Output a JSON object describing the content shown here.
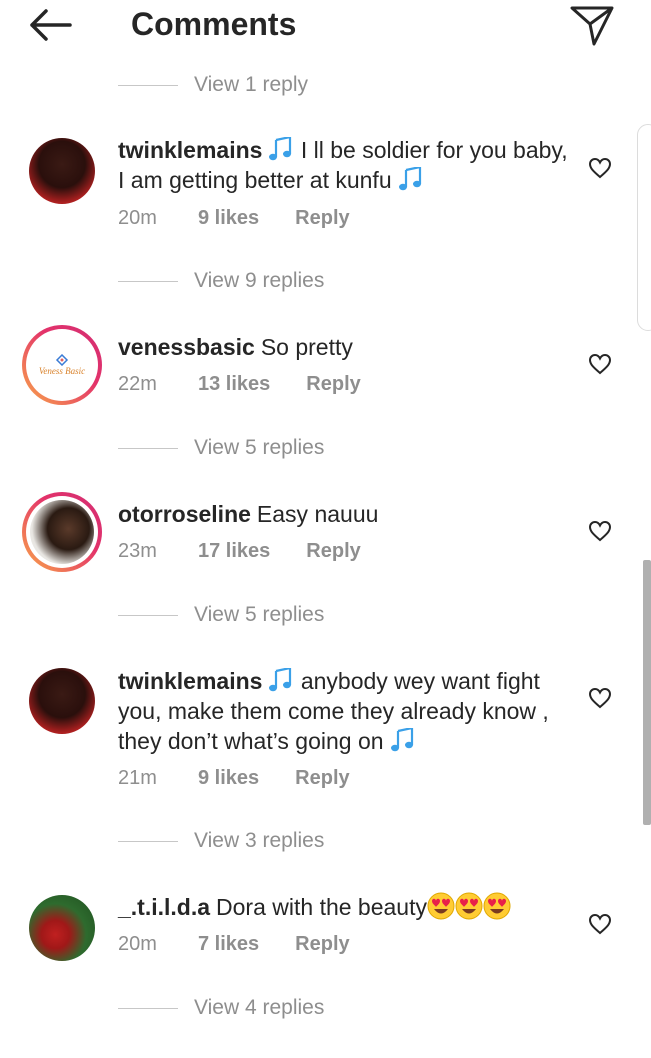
{
  "header": {
    "title": "Comments",
    "back_icon": "arrow-left-icon",
    "share_icon": "paper-plane-icon"
  },
  "top_view_replies": "View 1 reply",
  "comments": [
    {
      "username": "twinklemains",
      "text_a": "I ll be soldier for you baby, I am getting better at kunfu",
      "time": "20m",
      "likes": "9 likes",
      "reply": "Reply",
      "view_replies": "View 9 replies"
    },
    {
      "username": "venessbasic",
      "text": "So pretty",
      "time": "22m",
      "likes": "13 likes",
      "reply": "Reply",
      "view_replies": "View 5 replies",
      "avatar_text": "Veness Basic"
    },
    {
      "username": "otorroseline",
      "text": "Easy nauuu",
      "time": "23m",
      "likes": "17 likes",
      "reply": "Reply",
      "view_replies": "View 5 replies"
    },
    {
      "username": "twinklemains",
      "text_a": "anybody wey want fight you, make them come they already know , they don’t what’s going on",
      "time": "21m",
      "likes": "9 likes",
      "reply": "Reply",
      "view_replies": "View 3 replies"
    },
    {
      "username": "_.t.i.l.d.a",
      "text": "Dora with the beauty",
      "time": "20m",
      "likes": "7 likes",
      "reply": "Reply",
      "view_replies": "View 4 replies"
    }
  ],
  "colors": {
    "text": "#262626",
    "muted": "#8e8e8e",
    "note_blue": "#3aa0e8",
    "ring_start": "#f9a94a",
    "ring_end": "#d22f74"
  }
}
